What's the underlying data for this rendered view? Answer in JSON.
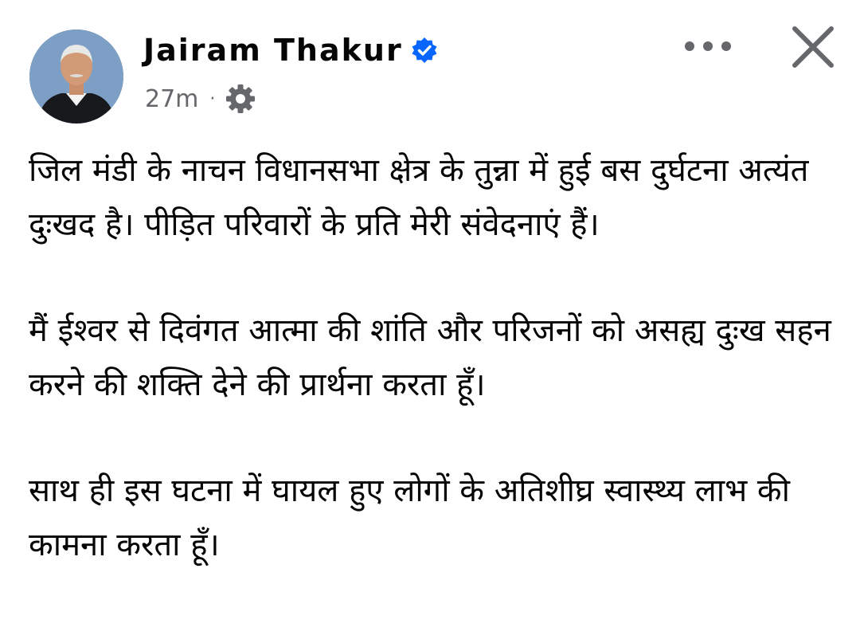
{
  "post": {
    "author_name": "Jairam Thakur",
    "verified_icon": "verified-badge-icon",
    "timestamp": "27m",
    "separator": "·",
    "audience_icon": "gear-icon",
    "paragraphs": [
      "जिल मंडी के नाचन विधानसभा क्षेत्र के तुन्ना में हुई बस दुर्घटना अत्यंत दुःखद है। पीड़ित परिवारों के प्रति मेरी संवेदनाएं हैं।",
      "मैं ईश्वर से दिवंगत आत्मा की शांति और परिजनों को असह्य दुःख सहन करने की शक्ति देने की प्रार्थना करता हूँ।",
      "साथ ही इस घटना में घायल हुए लोगों के अतिशीघ्र स्वास्थ्य लाभ की कामना करता हूँ।"
    ]
  },
  "controls": {
    "more_icon": "more-options-icon",
    "close_icon": "close-icon"
  },
  "colors": {
    "verified_blue": "#0866ff",
    "meta_gray": "#65676b",
    "text": "#050505",
    "icon_gray": "#65676b"
  }
}
